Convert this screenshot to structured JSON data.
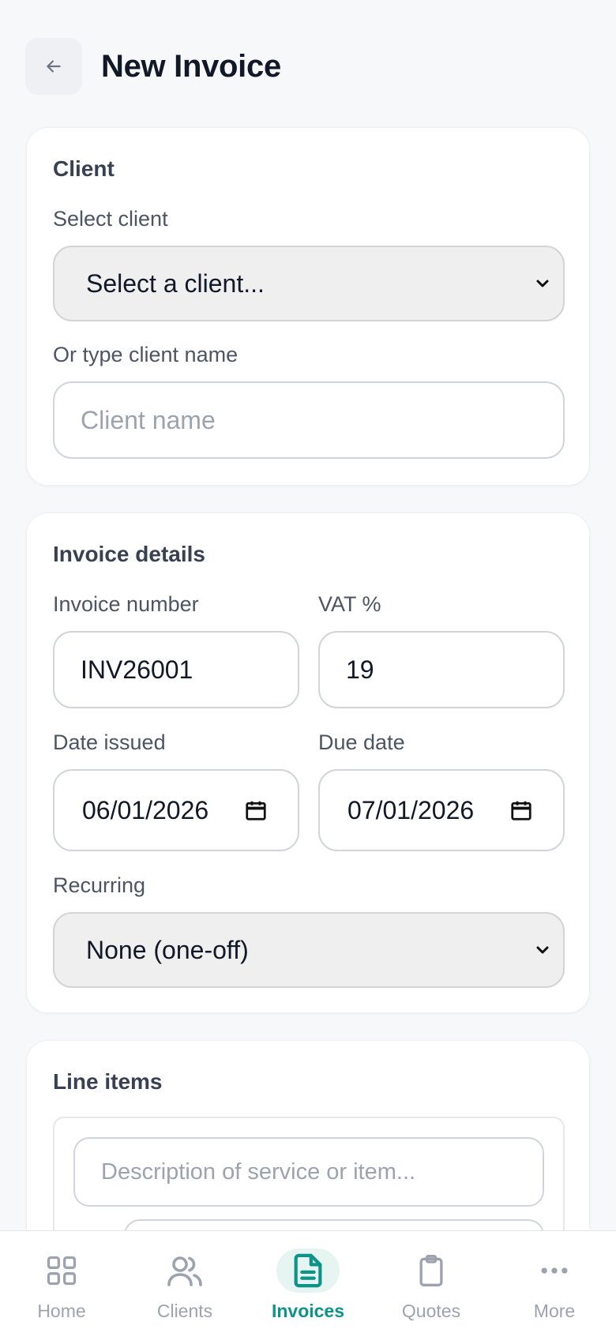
{
  "header": {
    "title": "New Invoice"
  },
  "client_card": {
    "title": "Client",
    "select_label": "Select client",
    "select_value": "Select a client...",
    "name_label": "Or type client name",
    "name_placeholder": "Client name"
  },
  "details_card": {
    "title": "Invoice details",
    "invoice_number_label": "Invoice number",
    "invoice_number_value": "INV26001",
    "vat_label": "VAT %",
    "vat_value": "19",
    "date_issued_label": "Date issued",
    "date_issued_value": "06/01/2026",
    "due_date_label": "Due date",
    "due_date_value": "07/01/2026",
    "recurring_label": "Recurring",
    "recurring_value": "None (one-off)"
  },
  "line_items_card": {
    "title": "Line items",
    "description_placeholder": "Description of service or item..."
  },
  "nav": {
    "items": [
      {
        "label": "Home",
        "icon": "grid-icon"
      },
      {
        "label": "Clients",
        "icon": "users-icon"
      },
      {
        "label": "Invoices",
        "icon": "document-icon",
        "active": true
      },
      {
        "label": "Quotes",
        "icon": "clipboard-icon"
      },
      {
        "label": "More",
        "icon": "more-dots-icon"
      }
    ]
  },
  "colors": {
    "accent": "#0d9488",
    "background": "#f7f8fa",
    "muted": "#9ca3af"
  }
}
